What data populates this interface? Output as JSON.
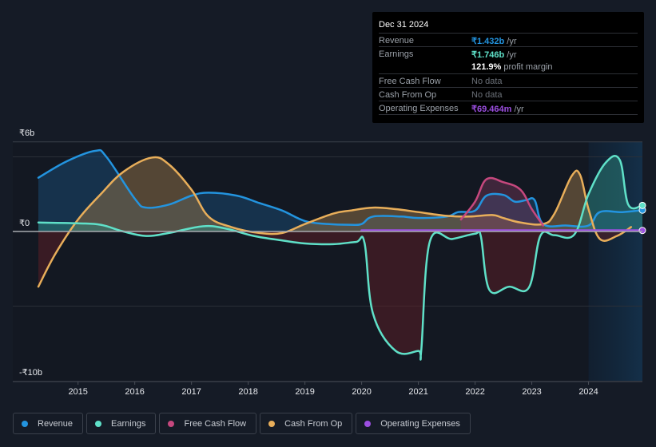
{
  "chart_data": {
    "type": "area",
    "title": "",
    "xlabel": "",
    "ylabel": "",
    "currency_symbol": "₹",
    "y_unit": "b",
    "ylim": [
      -10,
      6
    ],
    "xlim": [
      2014.3,
      2024.95
    ],
    "y_tick_labels": [
      {
        "value": 6,
        "label": "₹6b"
      },
      {
        "value": 0,
        "label": "₹0"
      },
      {
        "value": -10,
        "label": "-₹10b"
      }
    ],
    "gridlines": [
      5,
      0,
      -5
    ],
    "x_ticks": [
      2015,
      2016,
      2017,
      2018,
      2019,
      2020,
      2021,
      2022,
      2023,
      2024
    ],
    "x_tick_labels": [
      "2015",
      "2016",
      "2017",
      "2018",
      "2019",
      "2020",
      "2021",
      "2022",
      "2023",
      "2024"
    ],
    "highlight_start": 2024.0,
    "series": [
      {
        "name": "Revenue",
        "key": "revenue",
        "color": "#2394df",
        "points": [
          [
            2014.3,
            3.6
          ],
          [
            2014.8,
            4.7
          ],
          [
            2015.3,
            5.4
          ],
          [
            2015.5,
            5.0
          ],
          [
            2016.0,
            2.2
          ],
          [
            2016.2,
            1.6
          ],
          [
            2016.6,
            1.8
          ],
          [
            2017.0,
            2.4
          ],
          [
            2017.3,
            2.6
          ],
          [
            2017.8,
            2.4
          ],
          [
            2018.2,
            1.9
          ],
          [
            2018.6,
            1.4
          ],
          [
            2019.0,
            0.7
          ],
          [
            2019.4,
            0.5
          ],
          [
            2019.8,
            0.45
          ],
          [
            2020.0,
            0.5
          ],
          [
            2020.2,
            1.0
          ],
          [
            2020.7,
            1.0
          ],
          [
            2021.0,
            0.9
          ],
          [
            2021.5,
            1.0
          ],
          [
            2021.7,
            1.3
          ],
          [
            2022.0,
            1.4
          ],
          [
            2022.2,
            2.4
          ],
          [
            2022.5,
            2.45
          ],
          [
            2022.7,
            2.0
          ],
          [
            2022.9,
            2.1
          ],
          [
            2023.05,
            2.1
          ],
          [
            2023.2,
            0.5
          ],
          [
            2023.6,
            0.4
          ],
          [
            2024.0,
            0.4
          ],
          [
            2024.2,
            1.3
          ],
          [
            2024.6,
            1.3
          ],
          [
            2024.95,
            1.432
          ]
        ]
      },
      {
        "name": "Earnings",
        "key": "earnings",
        "color": "#5fe0c8",
        "points": [
          [
            2014.3,
            0.6
          ],
          [
            2015.0,
            0.55
          ],
          [
            2015.4,
            0.45
          ],
          [
            2015.8,
            0.0
          ],
          [
            2016.2,
            -0.3
          ],
          [
            2016.6,
            -0.1
          ],
          [
            2017.2,
            0.35
          ],
          [
            2017.6,
            0.2
          ],
          [
            2018.1,
            -0.3
          ],
          [
            2018.6,
            -0.6
          ],
          [
            2019.0,
            -0.8
          ],
          [
            2019.5,
            -0.85
          ],
          [
            2019.9,
            -0.7
          ],
          [
            2020.05,
            -0.75
          ],
          [
            2020.2,
            -5.5
          ],
          [
            2020.6,
            -8.0
          ],
          [
            2021.0,
            -8.0
          ],
          [
            2021.05,
            -8.0
          ],
          [
            2021.2,
            -0.7
          ],
          [
            2021.6,
            -0.5
          ],
          [
            2022.0,
            -0.15
          ],
          [
            2022.1,
            -0.3
          ],
          [
            2022.25,
            -3.9
          ],
          [
            2022.6,
            -3.7
          ],
          [
            2022.95,
            -3.75
          ],
          [
            2023.15,
            -0.3
          ],
          [
            2023.4,
            -0.25
          ],
          [
            2023.75,
            -0.2
          ],
          [
            2024.0,
            2.5
          ],
          [
            2024.3,
            4.6
          ],
          [
            2024.55,
            4.8
          ],
          [
            2024.7,
            1.8
          ],
          [
            2024.95,
            1.746
          ]
        ]
      },
      {
        "name": "Free Cash Flow",
        "key": "fcf",
        "color": "#c6487e",
        "points": [
          [
            2021.75,
            0.8
          ],
          [
            2022.0,
            2.0
          ],
          [
            2022.2,
            3.5
          ],
          [
            2022.5,
            3.3
          ],
          [
            2022.8,
            2.8
          ],
          [
            2023.0,
            1.5
          ],
          [
            2023.2,
            0.4
          ]
        ]
      },
      {
        "name": "Cash From Op",
        "key": "cfo",
        "color": "#e8ae5a",
        "points": [
          [
            2014.3,
            -3.7
          ],
          [
            2014.6,
            -1.5
          ],
          [
            2015.0,
            0.8
          ],
          [
            2015.4,
            2.5
          ],
          [
            2015.8,
            4.0
          ],
          [
            2016.3,
            4.95
          ],
          [
            2016.6,
            4.5
          ],
          [
            2017.0,
            2.8
          ],
          [
            2017.3,
            1.0
          ],
          [
            2017.7,
            0.3
          ],
          [
            2018.2,
            -0.1
          ],
          [
            2018.6,
            -0.1
          ],
          [
            2019.0,
            0.5
          ],
          [
            2019.5,
            1.2
          ],
          [
            2019.8,
            1.4
          ],
          [
            2020.2,
            1.6
          ],
          [
            2020.6,
            1.5
          ],
          [
            2021.0,
            1.3
          ],
          [
            2021.5,
            1.05
          ],
          [
            2021.9,
            1.0
          ],
          [
            2022.3,
            1.1
          ],
          [
            2022.5,
            0.9
          ],
          [
            2022.8,
            0.6
          ],
          [
            2023.2,
            0.5
          ],
          [
            2023.4,
            1.2
          ],
          [
            2023.7,
            3.7
          ],
          [
            2023.85,
            3.8
          ],
          [
            2024.0,
            1.5
          ],
          [
            2024.2,
            -0.5
          ],
          [
            2024.5,
            -0.3
          ],
          [
            2024.75,
            0.3
          ]
        ]
      },
      {
        "name": "Operating Expenses",
        "key": "opex",
        "color": "#9b4ee0",
        "points": [
          [
            2020.0,
            0.07
          ],
          [
            2021.0,
            0.07
          ],
          [
            2022.0,
            0.07
          ],
          [
            2023.0,
            0.07
          ],
          [
            2024.0,
            0.07
          ],
          [
            2024.95,
            0.069
          ]
        ]
      }
    ]
  },
  "tooltip": {
    "date": "Dec 31 2024",
    "rows": [
      {
        "label": "Revenue",
        "value": "₹1.432b",
        "suffix": " /yr",
        "color": "#2394df"
      },
      {
        "label": "Earnings",
        "value": "₹1.746b",
        "suffix": " /yr",
        "color": "#5fe0c8"
      },
      {
        "label": "",
        "value": "121.9%",
        "suffix": " profit margin",
        "color": "#ffffff"
      },
      {
        "label": "Free Cash Flow",
        "value": "No data",
        "suffix": "",
        "color": "#6b7078"
      },
      {
        "label": "Cash From Op",
        "value": "No data",
        "suffix": "",
        "color": "#6b7078"
      },
      {
        "label": "Operating Expenses",
        "value": "₹69.464m",
        "suffix": " /yr",
        "color": "#9b4ee0"
      }
    ]
  },
  "legend": [
    {
      "label": "Revenue",
      "color": "#2394df"
    },
    {
      "label": "Earnings",
      "color": "#5fe0c8"
    },
    {
      "label": "Free Cash Flow",
      "color": "#c6487e"
    },
    {
      "label": "Cash From Op",
      "color": "#e8ae5a"
    },
    {
      "label": "Operating Expenses",
      "color": "#9b4ee0"
    }
  ]
}
